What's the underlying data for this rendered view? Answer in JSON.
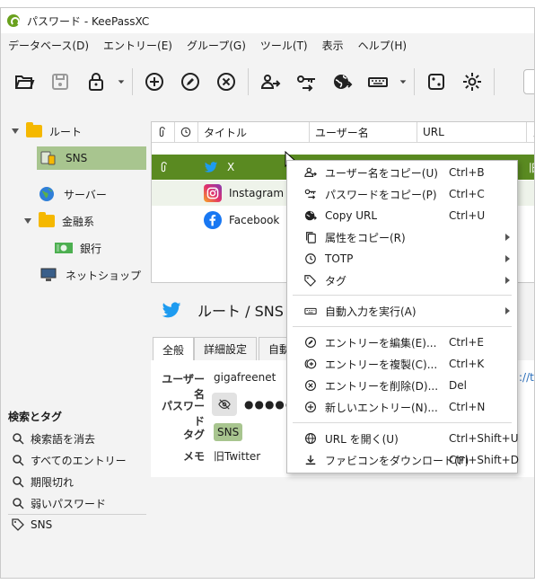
{
  "window": {
    "title": "パスワード - KeePassXC"
  },
  "menu": [
    "データベース(D)",
    "エントリー(E)",
    "グループ(G)",
    "ツール(T)",
    "表示",
    "ヘルプ(H)"
  ],
  "toolbar": {
    "icons": [
      "open-database-icon",
      "save-database-icon",
      "lock-database-icon",
      "dropdown-icon",
      "add-entry-icon",
      "edit-entry-icon",
      "delete-entry-icon",
      "copy-username-icon",
      "copy-password-icon",
      "open-url-icon",
      "auto-type-icon",
      "dropdown-icon",
      "password-generator-icon",
      "settings-icon"
    ]
  },
  "tree": {
    "root": "ルート",
    "sns": "SNS",
    "server": "サーバー",
    "finance": "金融系",
    "bank": "銀行",
    "netshop": "ネットショップ"
  },
  "search": {
    "heading": "検索とタグ",
    "items": [
      "検索語を消去",
      "すべてのエントリー",
      "期限切れ",
      "弱いパスワード"
    ],
    "tag": "SNS"
  },
  "table": {
    "columns": [
      "タイトル",
      "ユーザー名",
      "URL",
      "メ"
    ],
    "rows": [
      {
        "title": "X",
        "icon": "twitter-icon",
        "selected": true,
        "url_fragment": "旧"
      },
      {
        "title": "Instagram",
        "icon": "instagram-icon",
        "selected": false
      },
      {
        "title": "Facebook",
        "icon": "facebook-icon",
        "selected": false
      }
    ]
  },
  "preview": {
    "path": "ルート / SNS / X",
    "tabs": [
      "全般",
      "詳細設定",
      "自動"
    ],
    "username_label": "ユーザー名",
    "username": "gigafreenet",
    "password_label": "パスワード",
    "password_mask": "●●●●●●",
    "tags_label": "タグ",
    "tag": "SNS",
    "notes_label": "メモ",
    "notes": "旧Twitter",
    "url_fragment": "://tw"
  },
  "context_menu": {
    "items": [
      {
        "label": "ユーザー名をコピー(U)",
        "shortcut": "Ctrl+B",
        "icon": "copy-username-icon"
      },
      {
        "label": "パスワードをコピー(P)",
        "shortcut": "Ctrl+C",
        "icon": "copy-password-icon"
      },
      {
        "label": "Copy URL",
        "shortcut": "Ctrl+U",
        "icon": "copy-url-icon"
      },
      {
        "label": "属性をコピー(R)",
        "shortcut": "",
        "icon": "copy-attribute-icon",
        "submenu": true
      },
      {
        "label": "TOTP",
        "shortcut": "",
        "icon": "clock-icon",
        "submenu": true
      },
      {
        "label": "タグ",
        "shortcut": "",
        "icon": "tag-icon",
        "submenu": true
      },
      {
        "label": "自動入力を実行(A)",
        "shortcut": "",
        "icon": "keyboard-icon",
        "submenu": true
      },
      {
        "label": "エントリーを編集(E)...",
        "shortcut": "Ctrl+E",
        "icon": "edit-icon"
      },
      {
        "label": "エントリーを複製(C)...",
        "shortcut": "Ctrl+K",
        "icon": "clone-icon"
      },
      {
        "label": "エントリーを削除(D)...",
        "shortcut": "Del",
        "icon": "delete-icon"
      },
      {
        "label": "新しいエントリー(N)...",
        "shortcut": "Ctrl+N",
        "icon": "add-icon"
      },
      {
        "label": "URL を開く(U)",
        "shortcut": "Ctrl+Shift+U",
        "icon": "globe-icon"
      },
      {
        "label": "ファビコンをダウンロード(F)",
        "shortcut": "Ctrl+Shift+D",
        "icon": "download-icon"
      }
    ]
  },
  "colors": {
    "selection": "#5a8a21",
    "tree_selection": "#a8c58f",
    "accent": "#6aa11e"
  }
}
